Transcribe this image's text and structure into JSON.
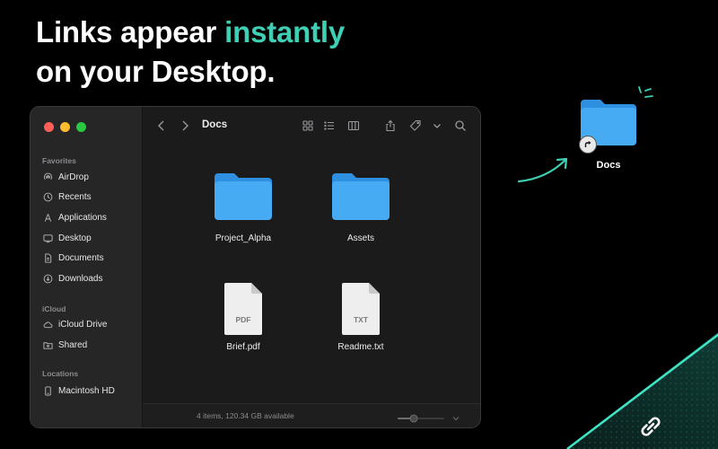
{
  "headline": {
    "line1_prefix": "Links appear ",
    "line1_accent": "instantly",
    "line2": "on your Desktop."
  },
  "colors": {
    "accent": "#3fcfb4",
    "folder": "#3fa6f2",
    "close": "#ff5f57",
    "minimize": "#febc2e",
    "zoom": "#28c840"
  },
  "finder": {
    "title": "Docs",
    "sidebar": {
      "favorites_header": "Favorites",
      "favorites": [
        {
          "label": "AirDrop",
          "icon": "airdrop-icon"
        },
        {
          "label": "Recents",
          "icon": "clock-icon"
        },
        {
          "label": "Applications",
          "icon": "applications-icon"
        },
        {
          "label": "Desktop",
          "icon": "desktop-icon"
        },
        {
          "label": "Documents",
          "icon": "document-icon"
        },
        {
          "label": "Downloads",
          "icon": "download-icon"
        }
      ],
      "icloud_header": "iCloud",
      "icloud": [
        {
          "label": "iCloud Drive",
          "icon": "cloud-icon"
        },
        {
          "label": "Shared",
          "icon": "shared-folder-icon"
        }
      ],
      "locations_header": "Locations",
      "locations": [
        {
          "label": "Macintosh HD",
          "icon": "disk-icon"
        }
      ]
    },
    "files": [
      {
        "name": "Project_Alpha",
        "kind": "folder"
      },
      {
        "name": "Assets",
        "kind": "folder"
      },
      {
        "name": "Brief.pdf",
        "kind": "document",
        "ext": "PDF"
      },
      {
        "name": "Readme.txt",
        "kind": "document",
        "ext": "TXT"
      }
    ],
    "status": "4 items, 120.34 GB available"
  },
  "desktop": {
    "alias_label": "Docs"
  }
}
